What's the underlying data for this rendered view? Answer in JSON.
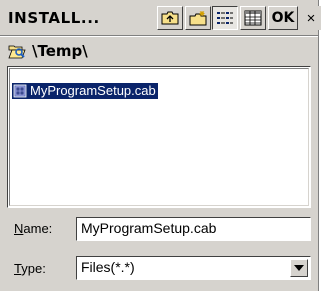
{
  "title": "INSTALL...",
  "toolbar": {
    "ok_label": "OK",
    "close_label": "×"
  },
  "path": "\\Temp\\",
  "files": [
    {
      "name": "MyProgramSetup.cab",
      "selected": true
    }
  ],
  "name_field": {
    "label_accel": "N",
    "label_rest": "ame:",
    "value": "MyProgramSetup.cab"
  },
  "type_field": {
    "label_accel": "T",
    "label_rest": "ype:",
    "value": "Files(*.*)"
  },
  "colors": {
    "dialog_bg": "#d6d3ce",
    "selection": "#0a246a"
  }
}
